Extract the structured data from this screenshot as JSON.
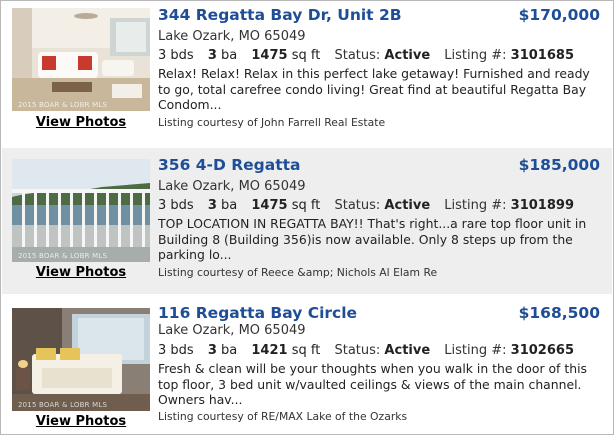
{
  "listings": [
    {
      "title": "344 Regatta Bay Dr, Unit 2B",
      "price": "$170,000",
      "city": "Lake Ozark, MO 65049",
      "beds": "3",
      "beds_label": "bds",
      "baths": "3",
      "baths_label": "ba",
      "sqft": "1475",
      "sqft_label": "sq ft",
      "status_label": "Status:",
      "status": "Active",
      "listing_label": "Listing #:",
      "listing_number": "3101685",
      "description": "Relax! Relax! Relax in this perfect lake getaway! Furnished and ready to go, total carefree condo living! Great find at beautiful Regatta Bay Condom...",
      "courtesy": "Listing courtesy of John Farrell Real Estate",
      "view_photos": "View Photos",
      "watermark": "2015 BOAR & LOBR MLS",
      "photo_icon": "living-room-photo-icon"
    },
    {
      "title": "356 4-D Regatta",
      "price": "$185,000",
      "city": "Lake Ozark, MO 65049",
      "beds": "3",
      "beds_label": "bds",
      "baths": "3",
      "baths_label": "ba",
      "sqft": "1475",
      "sqft_label": "sq ft",
      "status_label": "Status:",
      "status": "Active",
      "listing_label": "Listing #:",
      "listing_number": "3101899",
      "description": "TOP LOCATION IN REGATTA BAY!! That's right...a rare top floor unit in Building 8 (Building 356)is now available. Only 8 steps up from the parking lo...",
      "courtesy": "Listing courtesy of Reece &amp; Nichols Al Elam Re",
      "view_photos": "View Photos",
      "watermark": "2015 BOAR & LOBR MLS",
      "photo_icon": "balcony-lake-photo-icon"
    },
    {
      "title": "116 Regatta Bay Circle",
      "price": "$168,500",
      "city": "Lake Ozark, MO 65049",
      "beds": "3",
      "beds_label": "bds",
      "baths": "3",
      "baths_label": "ba",
      "sqft": "1421",
      "sqft_label": "sq ft",
      "status_label": "Status:",
      "status": "Active",
      "listing_label": "Listing #:",
      "listing_number": "3102665",
      "description": "Fresh & clean will be your thoughts when you walk in the door of this top floor, 3 bed unit w/vaulted ceilings & views of the main channel. Owners hav...",
      "courtesy": "Listing courtesy of RE/MAX Lake of the Ozarks",
      "view_photos": "View Photos",
      "watermark": "2015 BOAR & LOBR MLS",
      "photo_icon": "bedroom-photo-icon"
    }
  ],
  "colors": {
    "title": "#1f4e96",
    "alt_row": "#eeeeee",
    "border": "#b8b8b8"
  }
}
